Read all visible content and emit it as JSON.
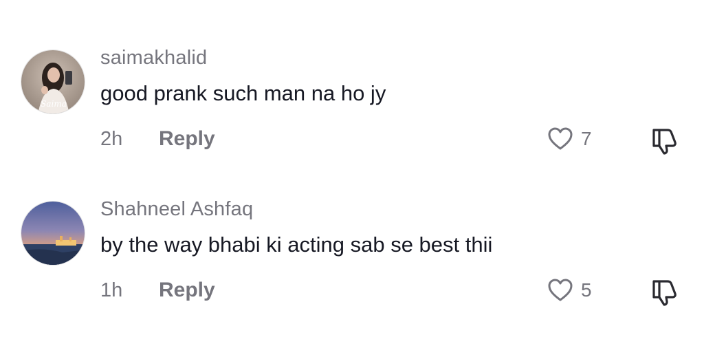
{
  "comments": [
    {
      "username": "saimakhalid",
      "avatar_caption": "Saima",
      "text": "good prank such man na ho jy",
      "time": "2h",
      "reply_label": "Reply",
      "likes": "7",
      "like_icon": "heart-outline-icon",
      "dislike_icon": "thumbs-down-icon"
    },
    {
      "username": "Shahneel Ashfaq",
      "text": "by the way bhabi ki acting sab se best thii",
      "time": "1h",
      "reply_label": "Reply",
      "likes": "5",
      "like_icon": "heart-outline-icon",
      "dislike_icon": "thumbs-down-icon"
    }
  ],
  "colors": {
    "primary_text": "#161823",
    "secondary_text": "#75757d"
  }
}
